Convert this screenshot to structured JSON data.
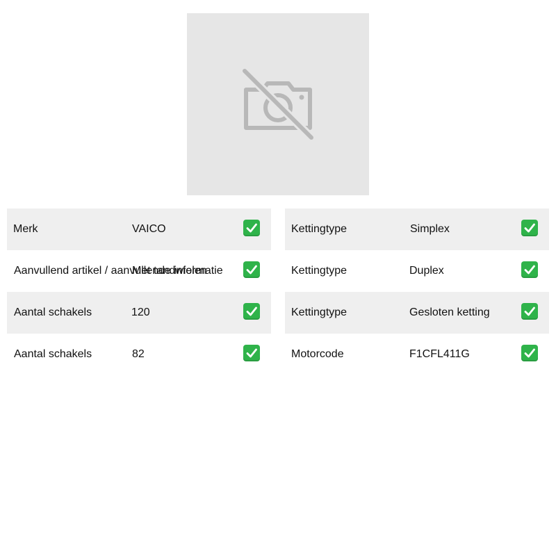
{
  "image": {
    "icon": "camera-off-icon"
  },
  "colors": {
    "check_green": "#2fb34a",
    "row_shade": "#efefef",
    "placeholder_bg": "#e6e6e6"
  },
  "left_table": [
    {
      "label": "Merk",
      "value": "VAICO",
      "checked": true
    },
    {
      "label": "Aanvullend artikel / aanvullende informatie",
      "value": "Met tandwielen",
      "checked": true
    },
    {
      "label": "Aantal schakels",
      "value": "120",
      "checked": true
    },
    {
      "label": "Aantal schakels",
      "value": "82",
      "checked": true
    }
  ],
  "right_table": [
    {
      "label": "Kettingtype",
      "value": "Simplex",
      "checked": true
    },
    {
      "label": "Kettingtype",
      "value": "Duplex",
      "checked": true
    },
    {
      "label": "Kettingtype",
      "value": "Gesloten ketting",
      "checked": true
    },
    {
      "label": "Motorcode",
      "value": "F1CFL411G",
      "checked": true
    }
  ]
}
